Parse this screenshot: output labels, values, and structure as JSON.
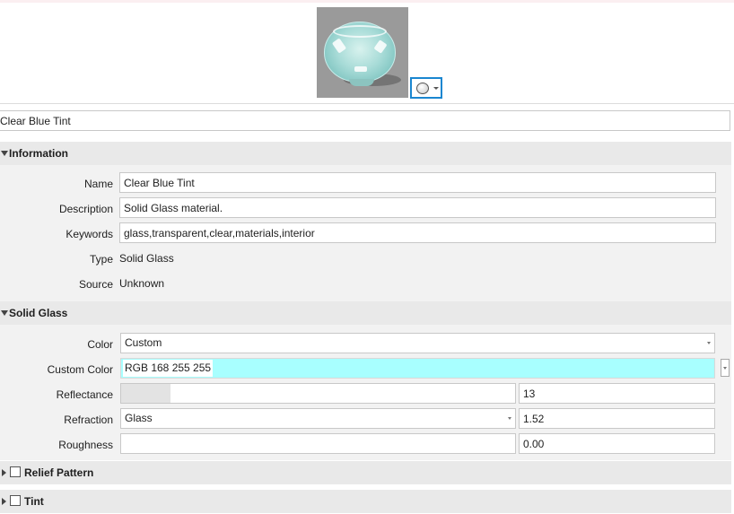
{
  "material_name": "Clear Blue Tint",
  "sections": {
    "information": {
      "title": "Information",
      "name_label": "Name",
      "name_value": "Clear Blue Tint",
      "description_label": "Description",
      "description_value": "Solid Glass material.",
      "keywords_label": "Keywords",
      "keywords_value": "glass,transparent,clear,materials,interior",
      "type_label": "Type",
      "type_value": "Solid Glass",
      "source_label": "Source",
      "source_value": "Unknown"
    },
    "solid_glass": {
      "title": "Solid Glass",
      "color_label": "Color",
      "color_value": "Custom",
      "custom_color_label": "Custom Color",
      "custom_color_value": "RGB 168 255 255",
      "custom_color_hex": "#a8ffff",
      "reflectance_label": "Reflectance",
      "reflectance_value": "13",
      "reflectance_fraction": 0.13,
      "refraction_label": "Refraction",
      "refraction_preset": "Glass",
      "refraction_value": "1.52",
      "roughness_label": "Roughness",
      "roughness_value": "0.00",
      "roughness_fraction": 0.0
    },
    "relief_pattern": {
      "title": "Relief Pattern",
      "checked": false
    },
    "tint": {
      "title": "Tint",
      "checked": false
    }
  },
  "icons": {
    "preview": "glass-bowl-preview",
    "shape_selector": "sphere-icon",
    "expand_collapse": "triangle-icon",
    "dropdown": "chevron-down-icon"
  }
}
